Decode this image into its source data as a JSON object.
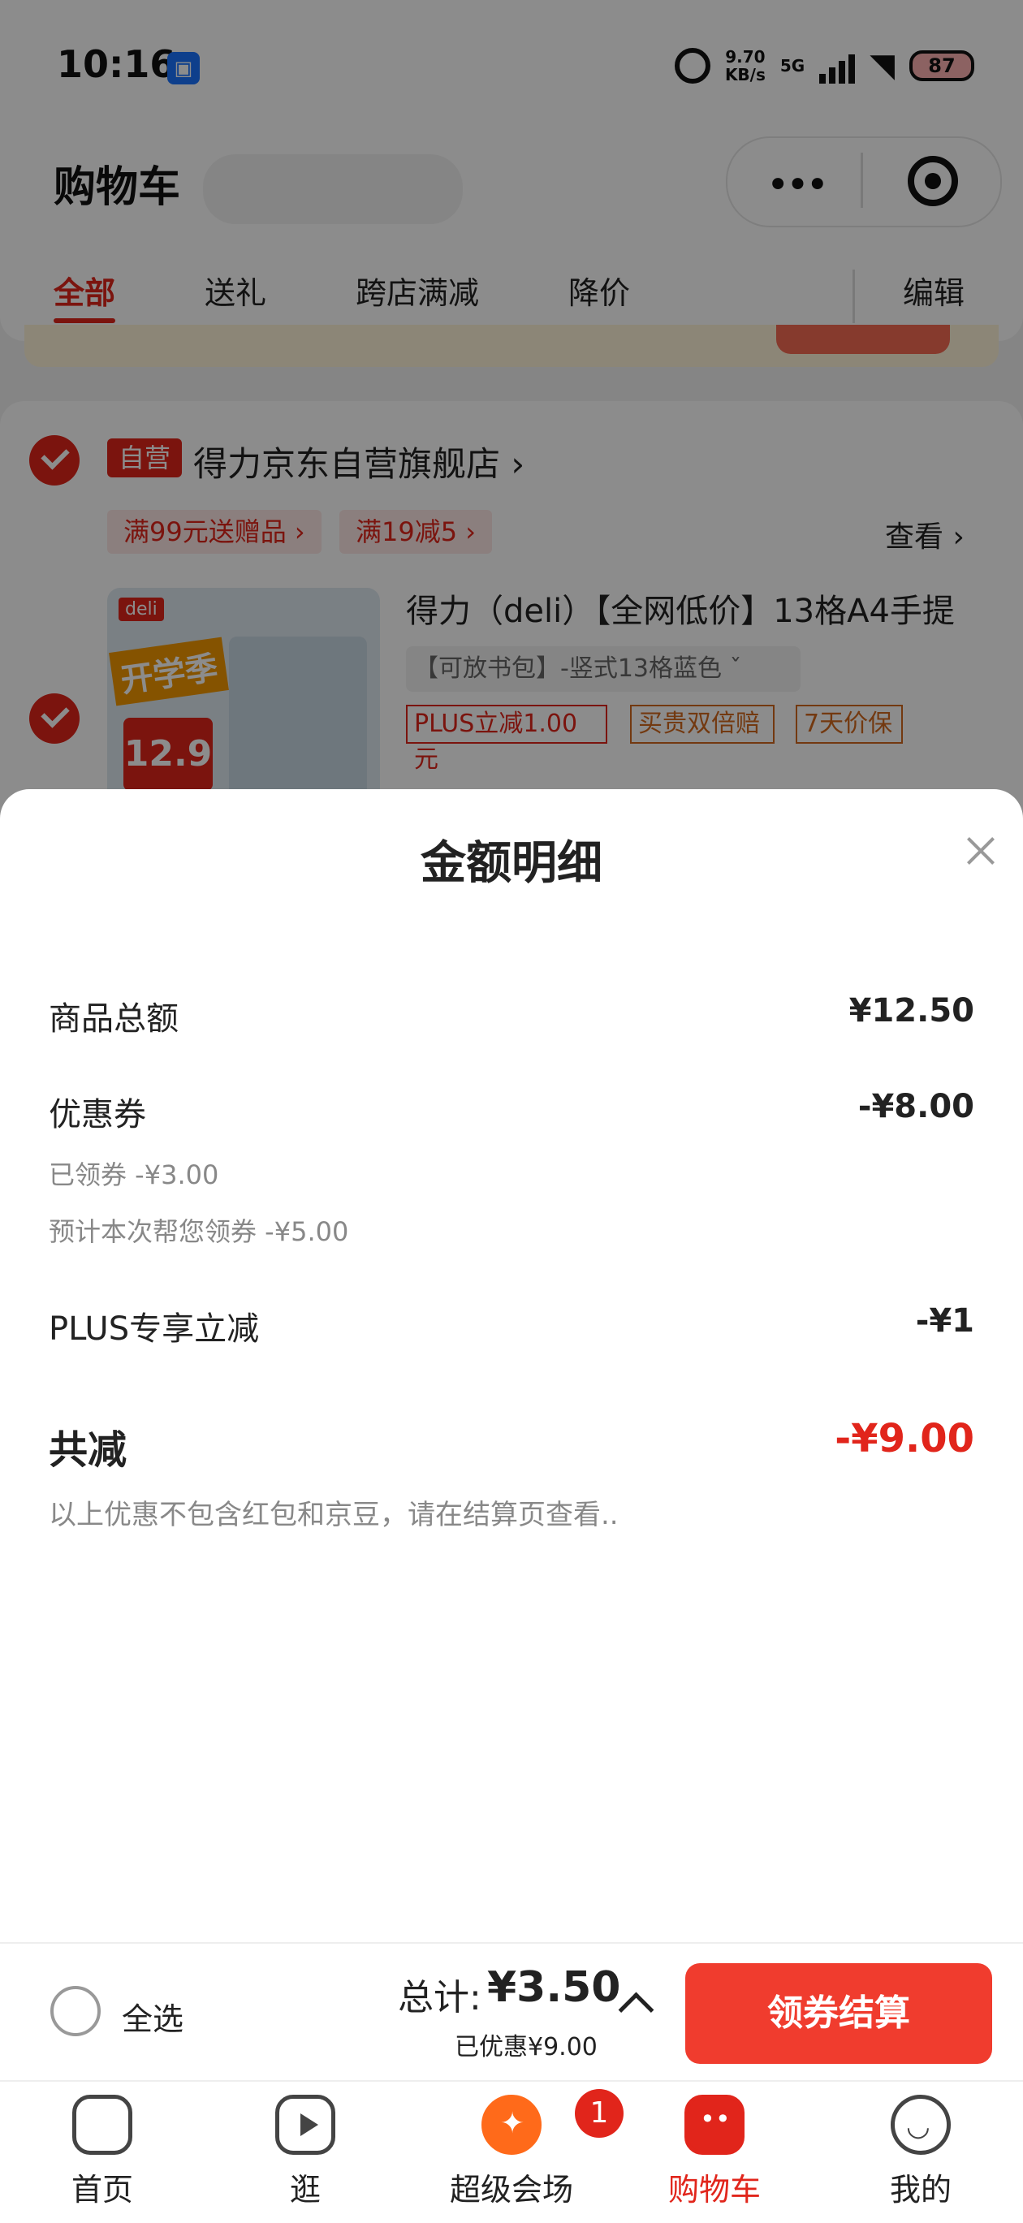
{
  "status_bar": {
    "time": "10:16",
    "network_speed": "9.70\nKB/s",
    "network_type": "5G",
    "battery": "87"
  },
  "header": {
    "title": "购物车",
    "capsule_more": "•••"
  },
  "tabs": [
    {
      "label": "全部",
      "active": true
    },
    {
      "label": "送礼"
    },
    {
      "label": "跨店满减"
    },
    {
      "label": "降价"
    }
  ],
  "edit_label": "编辑",
  "store": {
    "badge": "自营",
    "name": "得力京东自营旗舰店 ›",
    "promos": [
      "满99元送赠品 ›",
      "满19减5 ›"
    ],
    "view_more": "查看 ›"
  },
  "product": {
    "image_brand": "deli",
    "image_tag": "开学季",
    "image_price": "12.9",
    "title": "得力（deli）【全网低价】13格A4手提",
    "spec": "【可放书包】-竖式13格蓝色  ˇ",
    "tags": [
      {
        "label": "PLUS立减1.00元",
        "color": "#e1251b"
      },
      {
        "label": "买贵双倍赔",
        "color": "#d2691e"
      },
      {
        "label": "7天价保",
        "color": "#d2691e"
      }
    ]
  },
  "sheet": {
    "title": "金额明细",
    "rows": {
      "goods_total_label": "商品总额",
      "goods_total_value": "¥12.50",
      "coupon_label": "优惠券",
      "coupon_value": "-¥8.00",
      "coupon_claimed": "已领券 -¥3.00",
      "coupon_estimated": "预计本次帮您领券 -¥5.00",
      "plus_label": "PLUS专享立减",
      "plus_value": "-¥1"
    },
    "total_label": "共减",
    "total_value": "-¥9.00",
    "note": "以上优惠不包含红包和京豆，请在结算页查看.."
  },
  "checkout": {
    "select_all": "全选",
    "sum_label": "总计:",
    "sum_value": "¥3.50",
    "saved": "已优惠¥9.00",
    "pay_button": "领券结算"
  },
  "nav": {
    "items": [
      {
        "label": "首页",
        "icon": "home-icon"
      },
      {
        "label": "逛",
        "icon": "play-icon"
      },
      {
        "label": "超级会场",
        "icon": "super-venue-icon",
        "badge": "1"
      },
      {
        "label": "购物车",
        "icon": "cart-icon",
        "active": true
      },
      {
        "label": "我的",
        "icon": "profile-icon"
      }
    ]
  },
  "colors": {
    "accent": "#e1251b",
    "pay_button": "#f03c2e"
  }
}
